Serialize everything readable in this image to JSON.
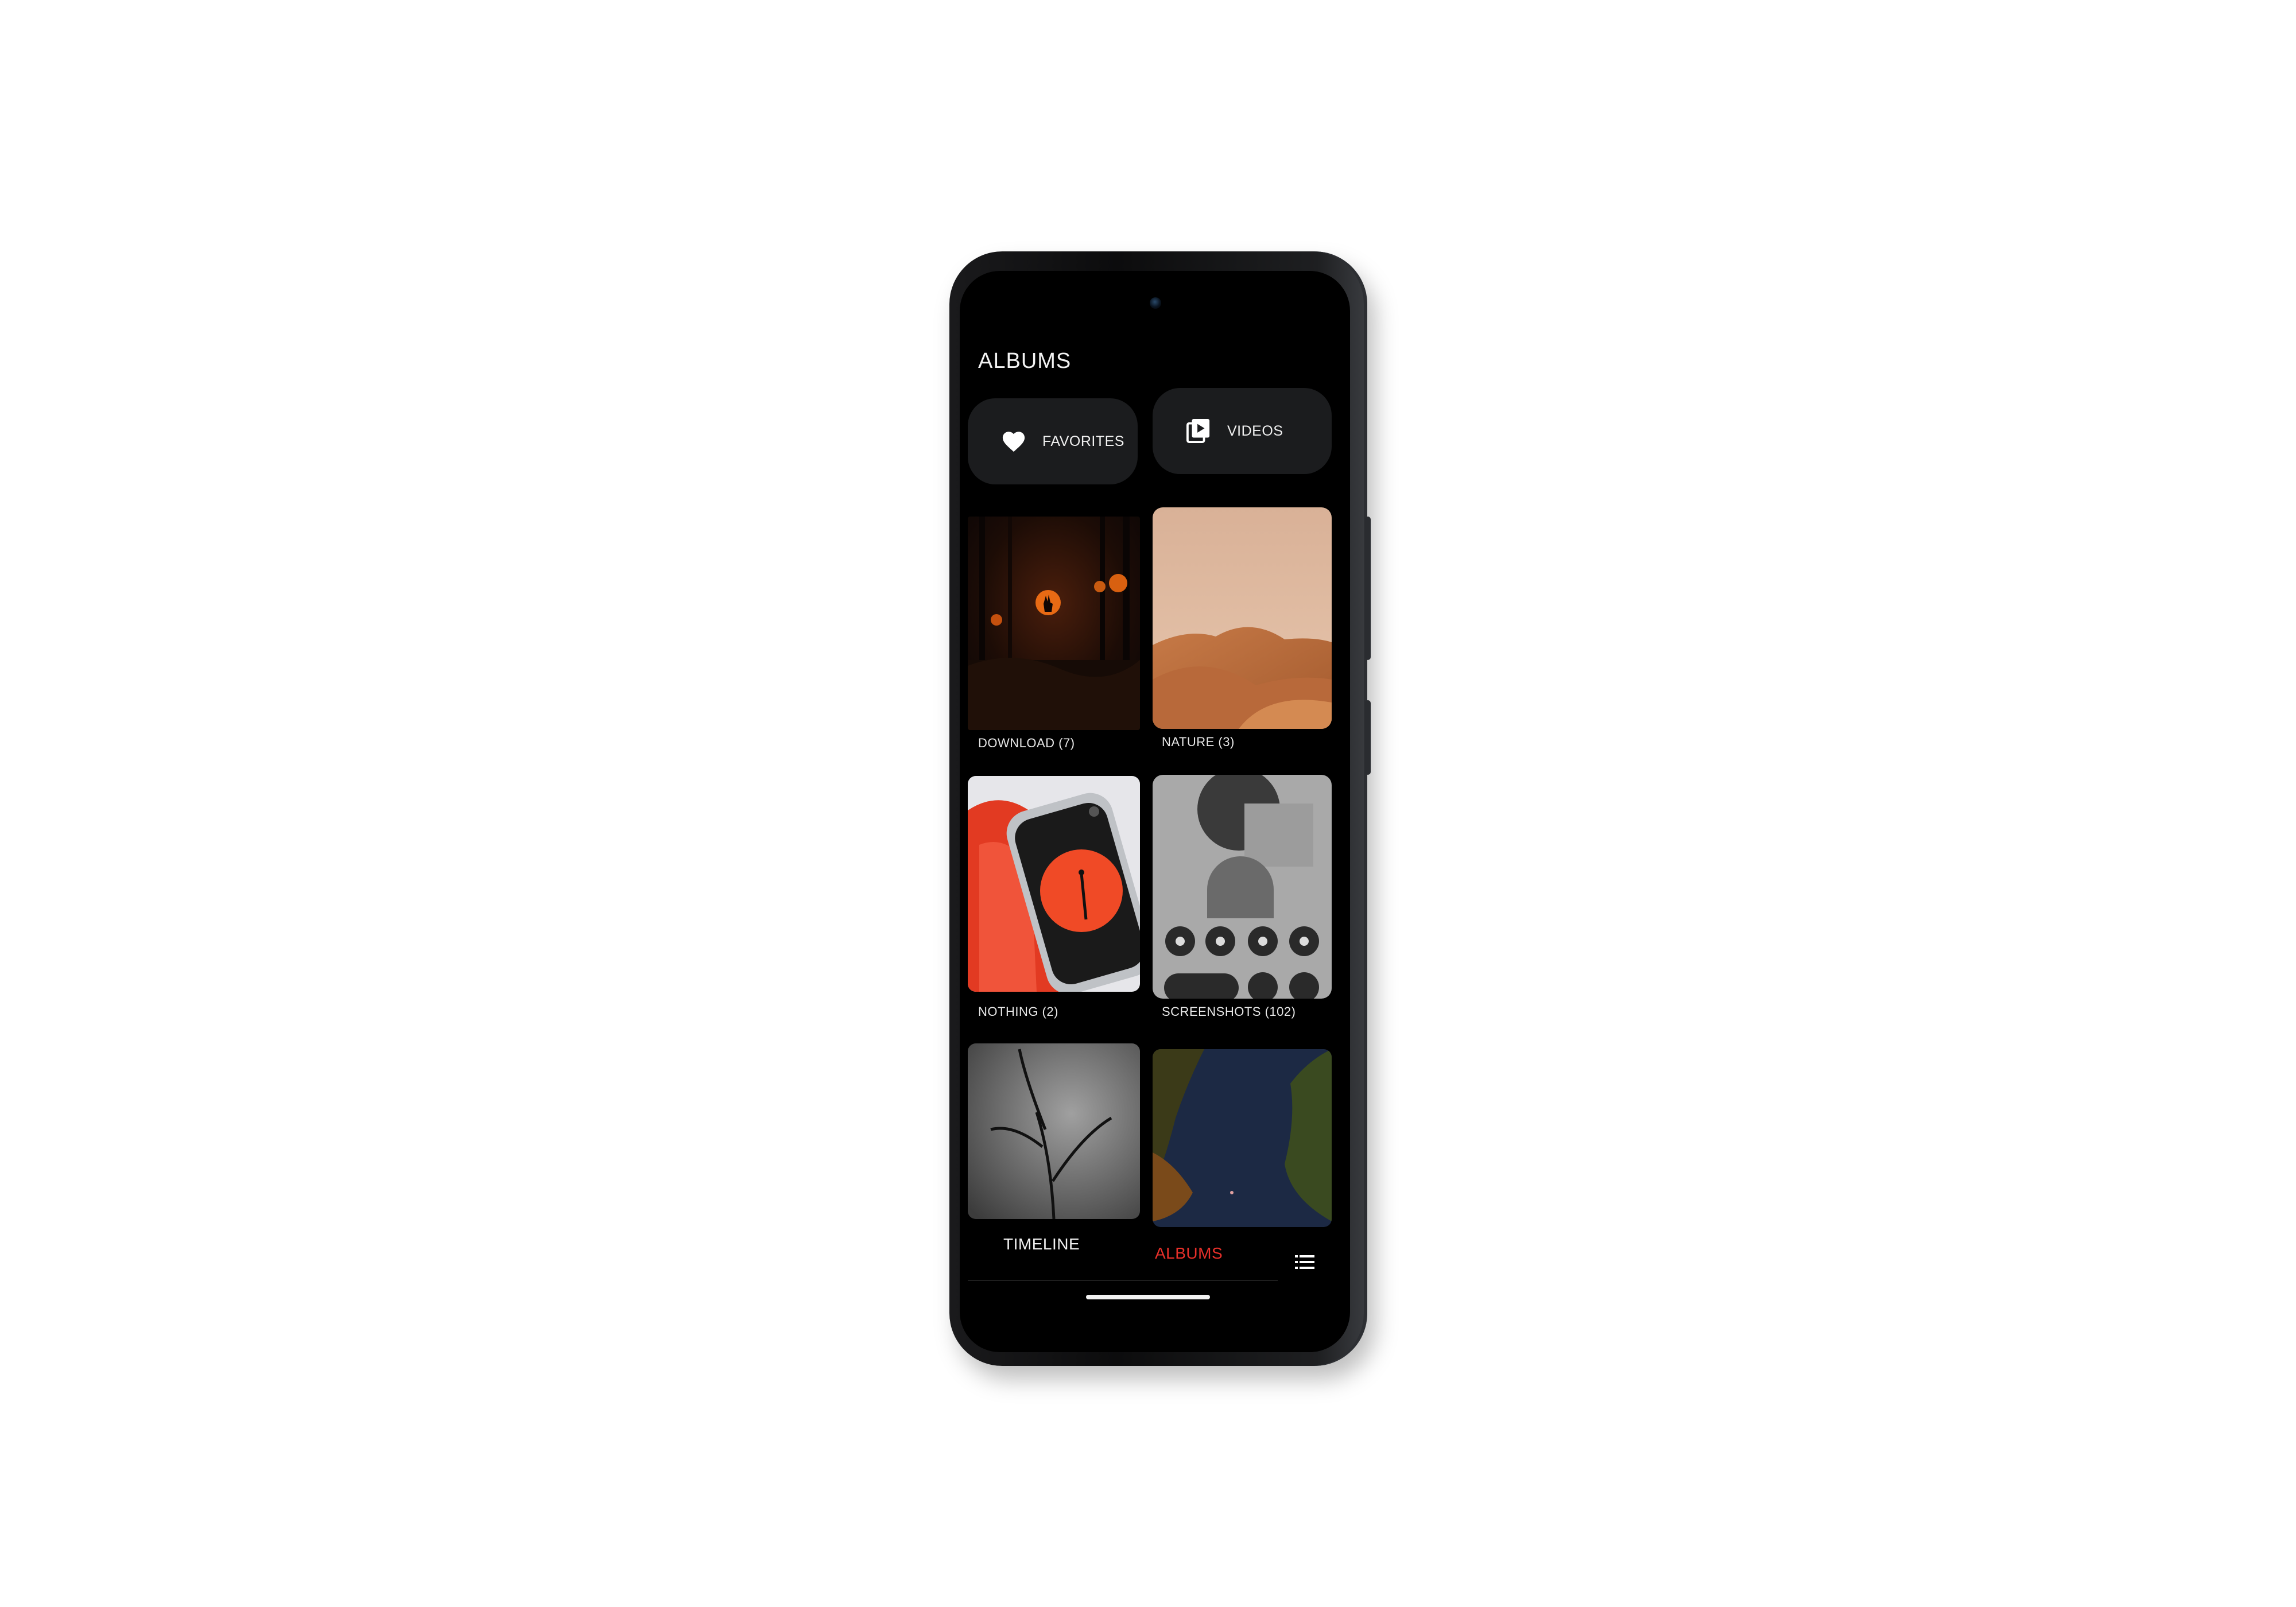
{
  "header": {
    "title": "ALBUMS"
  },
  "quick_access": [
    {
      "label": "FAVORITES",
      "icon": "heart-icon"
    },
    {
      "label": "VIDEOS",
      "icon": "video-library-icon"
    }
  ],
  "albums": [
    {
      "caption": "DOWNLOAD (7)"
    },
    {
      "caption": "NATURE (3)"
    },
    {
      "caption": "NOTHING (2)"
    },
    {
      "caption": "SCREENSHOTS (102)"
    }
  ],
  "nav": {
    "timeline": "TIMELINE",
    "albums": "ALBUMS",
    "menu_icon": "list-menu-icon"
  },
  "colors": {
    "accent": "#e8302a",
    "background": "#000000",
    "card": "#1b1c1e",
    "text": "#f2f2f2"
  }
}
